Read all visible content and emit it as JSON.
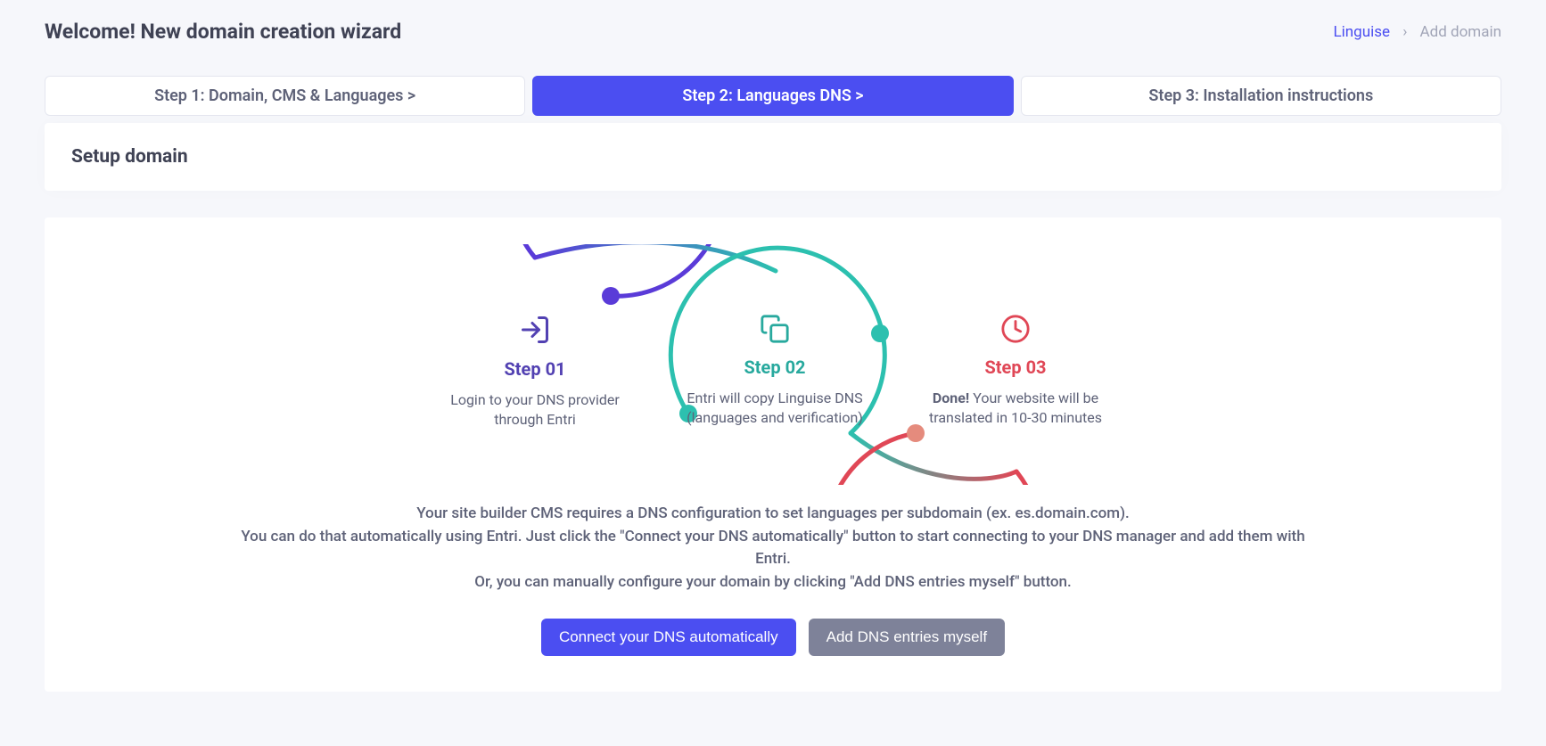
{
  "header": {
    "title": "Welcome! New domain creation wizard",
    "breadcrumb": {
      "home": "Linguise",
      "current": "Add domain"
    }
  },
  "tabs": {
    "step1": "Step 1: Domain, CMS & Languages  >",
    "step2": "Step 2: Languages DNS  >",
    "step3": "Step 3: Installation instructions"
  },
  "card": {
    "title": "Setup domain"
  },
  "diagram": {
    "step1": {
      "label": "Step 01",
      "desc": "Login to your DNS provider through Entri"
    },
    "step2": {
      "label": "Step 02",
      "desc": "Entri will copy Linguise DNS (languages and verification)"
    },
    "step3": {
      "label": "Step 03",
      "bold": "Done!",
      "rest": " Your website will be translated in 10-30 minutes"
    }
  },
  "description": {
    "line1": "Your site builder CMS requires a DNS configuration to set languages per subdomain (ex. es.domain.com).",
    "line2": "You can do that automatically using Entri. Just click the \"Connect your DNS automatically\" button to start connecting to your DNS manager and add them with Entri.",
    "line3": "Or, you can manually configure your domain by clicking \"Add DNS entries myself\" button."
  },
  "buttons": {
    "connect": "Connect your DNS automatically",
    "manual": "Add DNS entries myself"
  },
  "colors": {
    "primary": "#4b4ef1",
    "purple": "#5241b2",
    "teal": "#28a99e",
    "red": "#e04756"
  }
}
